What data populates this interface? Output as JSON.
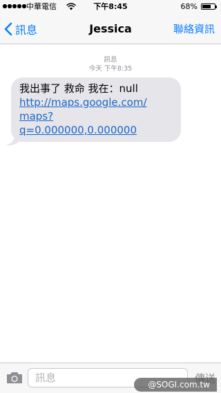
{
  "status_bar": {
    "carrier": "中華電信",
    "time": "下午8:45",
    "battery_percent_label": "68%",
    "battery_level": 0.68
  },
  "nav": {
    "back_label": "訊息",
    "title": "Jessica",
    "contact_label": "聯絡資訊"
  },
  "conversation": {
    "service_label": "訊息",
    "timestamp": "今天 下午8:35",
    "message": {
      "text_line": "我出事了 救命 我在：null",
      "link_lines": [
        "http://maps.google.com/",
        "maps?",
        "q=0.000000,0.000000"
      ]
    }
  },
  "input": {
    "placeholder": "訊息",
    "send_label": "傳送"
  },
  "watermark": "@SOGI.com.tw",
  "colors": {
    "accent": "#0a7cff",
    "bubble": "#e5e5ea",
    "link": "#1a66c9",
    "meta_text": "#8e8e93"
  },
  "icons": [
    "signal-dots-icon",
    "wifi-icon",
    "battery-icon",
    "chevron-left-icon",
    "camera-icon"
  ]
}
